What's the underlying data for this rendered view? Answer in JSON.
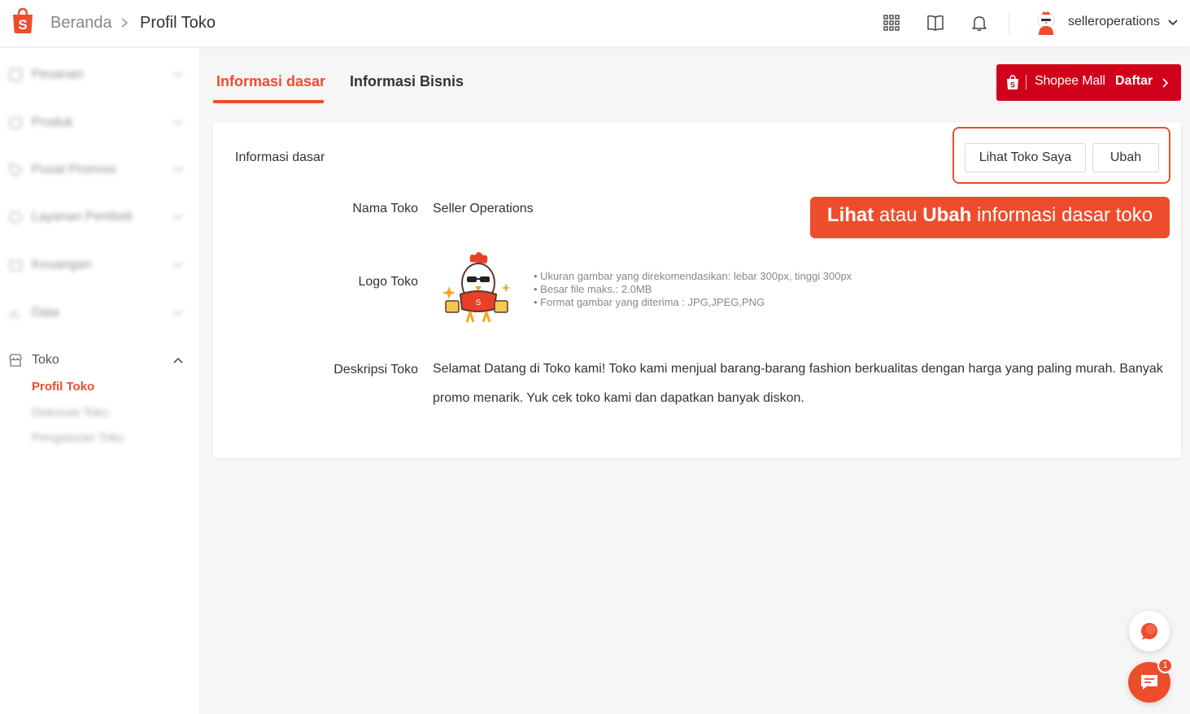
{
  "header": {
    "breadcrumb_home": "Beranda",
    "breadcrumb_current": "Profil Toko",
    "username": "selleroperations"
  },
  "sidebar": {
    "items": [
      {
        "label": "Pesanan",
        "icon": "clipboard-icon",
        "blurred": true
      },
      {
        "label": "Produk",
        "icon": "box-icon",
        "blurred": true
      },
      {
        "label": "Pusat Promosi",
        "icon": "tag-icon",
        "blurred": true
      },
      {
        "label": "Layanan Pembeli",
        "icon": "headset-icon",
        "blurred": true
      },
      {
        "label": "Keuangan",
        "icon": "wallet-icon",
        "blurred": true
      },
      {
        "label": "Data",
        "icon": "chart-icon",
        "blurred": true
      },
      {
        "label": "Toko",
        "icon": "store-icon",
        "blurred": false
      }
    ],
    "toko_sub": [
      {
        "label": "Profil Toko",
        "active": true
      },
      {
        "label": "Dekorasi Toko",
        "active": false
      },
      {
        "label": "Pengaturan Toko",
        "active": false
      }
    ]
  },
  "tabs": [
    {
      "label": "Informasi dasar",
      "active": true
    },
    {
      "label": "Informasi Bisnis",
      "active": false
    }
  ],
  "mall_banner": {
    "brand": "Shopee Mall",
    "action": "Daftar"
  },
  "card": {
    "title": "Informasi dasar",
    "view_button": "Lihat Toko Saya",
    "edit_button": "Ubah",
    "callout": {
      "word1": "Lihat",
      "mid": " atau ",
      "word2": "Ubah",
      "rest": " informasi dasar toko"
    },
    "fields": {
      "name_label": "Nama Toko",
      "name_value": "Seller Operations",
      "logo_label": "Logo Toko",
      "logo_hints": [
        "Ukuran gambar yang direkomendasikan: lebar 300px, tinggi 300px",
        "Besar file maks.: 2.0MB",
        "Format gambar yang diterima : JPG,JPEG,PNG"
      ],
      "desc_label": "Deskripsi Toko",
      "desc_value": "Selamat Datang di Toko kami! Toko kami menjual barang-barang fashion berkualitas dengan harga yang paling murah. Banyak promo menarik. Yuk cek toko kami dan dapatkan banyak diskon."
    }
  },
  "chat_badge": "1",
  "colors": {
    "accent": "#ee4d2d",
    "mall": "#d0011b"
  }
}
